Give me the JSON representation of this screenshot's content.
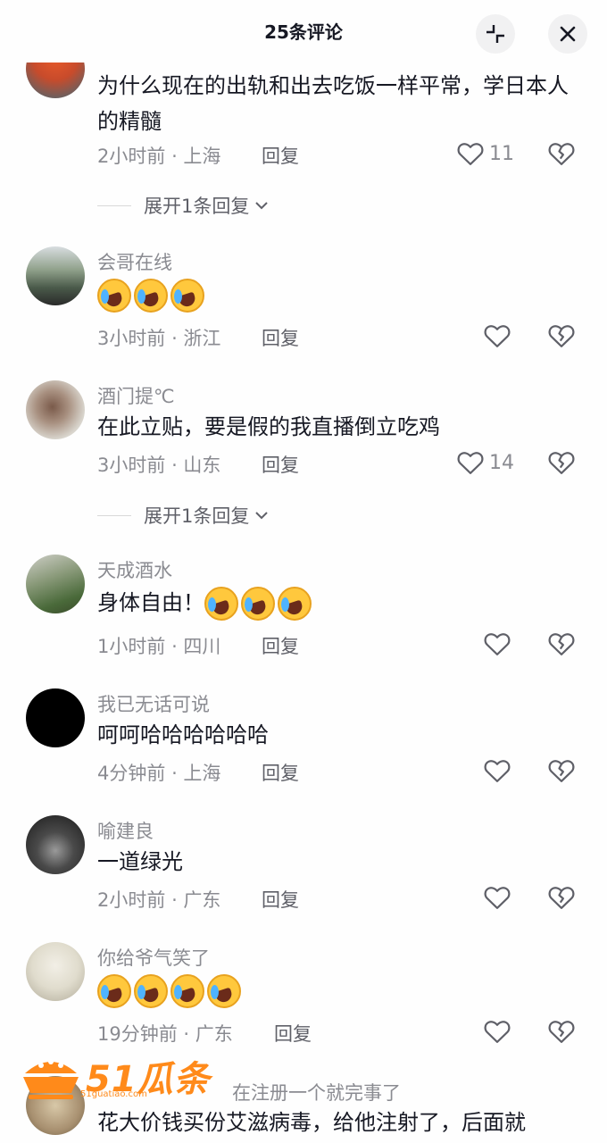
{
  "header": {
    "title": "25条评论",
    "collapse_icon": "collapse-icon",
    "close_icon": "close-icon"
  },
  "comments": [
    {
      "username": "",
      "text": "为什么现在的出轨和出去吃饭一样平常，学日本人的精髓",
      "time": "2小时前",
      "location": "上海",
      "reply": "回复",
      "likes": "11",
      "avatar_color": "#c84b2b"
    },
    {
      "username": "会哥在线",
      "text": "",
      "emoji_count": 3,
      "time": "3小时前",
      "location": "浙江",
      "reply": "回复",
      "likes": "",
      "avatar_color": "#6a7a6a"
    },
    {
      "username": "酒门提℃",
      "text": "在此立贴，要是假的我直播倒立吃鸡",
      "time": "3小时前",
      "location": "山东",
      "reply": "回复",
      "likes": "14",
      "avatar_color": "#8a6a5a"
    },
    {
      "username": "天成酒水",
      "text": "身体自由！",
      "emoji_count": 3,
      "time": "1小时前",
      "location": "四川",
      "reply": "回复",
      "likes": "",
      "avatar_color": "#5a7a4a"
    },
    {
      "username": "我已无话可说",
      "text": "呵呵哈哈哈哈哈哈",
      "time": "4分钟前",
      "location": "上海",
      "reply": "回复",
      "likes": "",
      "avatar_color": "#000000"
    },
    {
      "username": "喻建良",
      "text": "一道绿光",
      "time": "2小时前",
      "location": "广东",
      "reply": "回复",
      "likes": "",
      "avatar_color": "#3a3a3a"
    },
    {
      "username": "你给爷气笑了",
      "text": "",
      "emoji_count": 4,
      "time": "19分钟前",
      "location": "广东",
      "reply": "回复",
      "likes": "",
      "avatar_color": "#e8e4d8"
    },
    {
      "username": "",
      "text": "花大价钱买份艾滋病毒，给他注射了，后面就",
      "partial_username": "在注册一个就完事了",
      "avatar_color": "#b8a68a"
    }
  ],
  "expand_replies": [
    "展开1条回复",
    "展开1条回复"
  ],
  "watermark": {
    "brand": "51瓜条",
    "sub": "51guatiao.com"
  },
  "colors": {
    "text": "#161823",
    "secondary": "#8a8b91",
    "background": "#fefefe",
    "watermark": "#ff8a1a"
  }
}
